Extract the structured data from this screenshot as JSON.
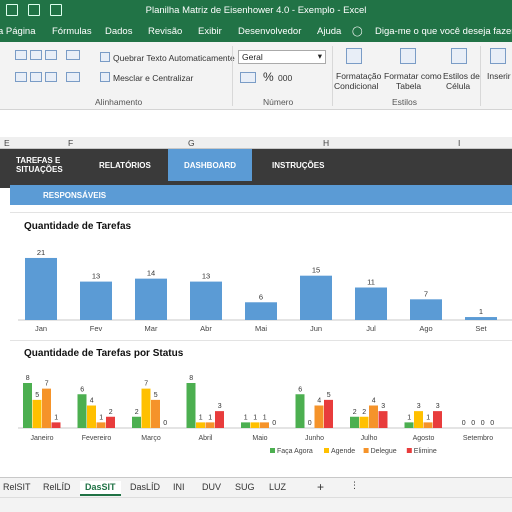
{
  "window": {
    "title": "Planilha Matriz de Eisenhower 4.0 - Exemplo  -  Excel"
  },
  "ribbon_tabs": [
    "a Página",
    "Fórmulas",
    "Dados",
    "Revisão",
    "Exibir",
    "Desenvolvedor",
    "Ajuda",
    "Diga-me o que você deseja fazer"
  ],
  "ribbon": {
    "wrap_text": "Quebrar Texto Automaticamente",
    "merge_center": "Mesclar e Centralizar",
    "number_format": "Geral",
    "percent": "%",
    "thousands": "000",
    "cond_format_1": "Formatação",
    "cond_format_2": "Condicional",
    "format_table_1": "Formatar como",
    "format_table_2": "Tabela",
    "cell_styles_1": "Estilos de",
    "cell_styles_2": "Célula",
    "insert": "Inserir",
    "group_alignment": "Alinhamento",
    "group_number": "Número",
    "group_styles": "Estilos"
  },
  "columns": [
    "E",
    "F",
    "G",
    "H",
    "I"
  ],
  "dashboard_nav": {
    "tab1_line1": "TAREFAS E",
    "tab1_line2": "SITUAÇÕES",
    "tab2": "RELATÓRIOS",
    "tab3": "DASHBOARD",
    "tab4": "INSTRUÇÕES",
    "sub": "RESPONSÁVEIS"
  },
  "colors": {
    "excel_green": "#217346",
    "bar_blue": "#5b9bd5",
    "faca": "#4caf50",
    "agende": "#ffc000",
    "delegue": "#f5932a",
    "elimine": "#e83c3c"
  },
  "chart_data": [
    {
      "type": "bar",
      "title": "Quantidade de Tarefas",
      "categories": [
        "Jan",
        "Fev",
        "Mar",
        "Abr",
        "Mai",
        "Jun",
        "Jul",
        "Ago",
        "Set"
      ],
      "values": [
        21,
        13,
        14,
        13,
        6,
        15,
        11,
        7,
        1
      ],
      "ylim": [
        0,
        22
      ],
      "grid": false,
      "data_labels": true
    },
    {
      "type": "bar",
      "title": "Quantidade de Tarefas por Status",
      "categories": [
        "Janeiro",
        "Fevereiro",
        "Março",
        "Abril",
        "Maio",
        "Junho",
        "Julho",
        "Agosto",
        "Setembro"
      ],
      "series": [
        {
          "name": "Faça Agora",
          "values": [
            8,
            6,
            2,
            8,
            1,
            6,
            2,
            1,
            0
          ]
        },
        {
          "name": "Agende",
          "values": [
            5,
            4,
            7,
            1,
            1,
            0,
            2,
            3,
            0
          ]
        },
        {
          "name": "Delegue",
          "values": [
            7,
            1,
            5,
            1,
            1,
            4,
            4,
            1,
            0
          ]
        },
        {
          "name": "Elimine",
          "values": [
            1,
            2,
            0,
            3,
            0,
            5,
            3,
            3,
            0
          ]
        }
      ],
      "ylim": [
        0,
        9
      ],
      "legend": "bottom",
      "data_labels": true
    }
  ],
  "sheet_tabs": [
    "RelSIT",
    "RelLÍD",
    "DasSIT",
    "DasLÍD",
    "INI",
    "DUV",
    "SUG",
    "LUZ"
  ],
  "active_sheet": "DasSIT",
  "add_sheet": "+"
}
